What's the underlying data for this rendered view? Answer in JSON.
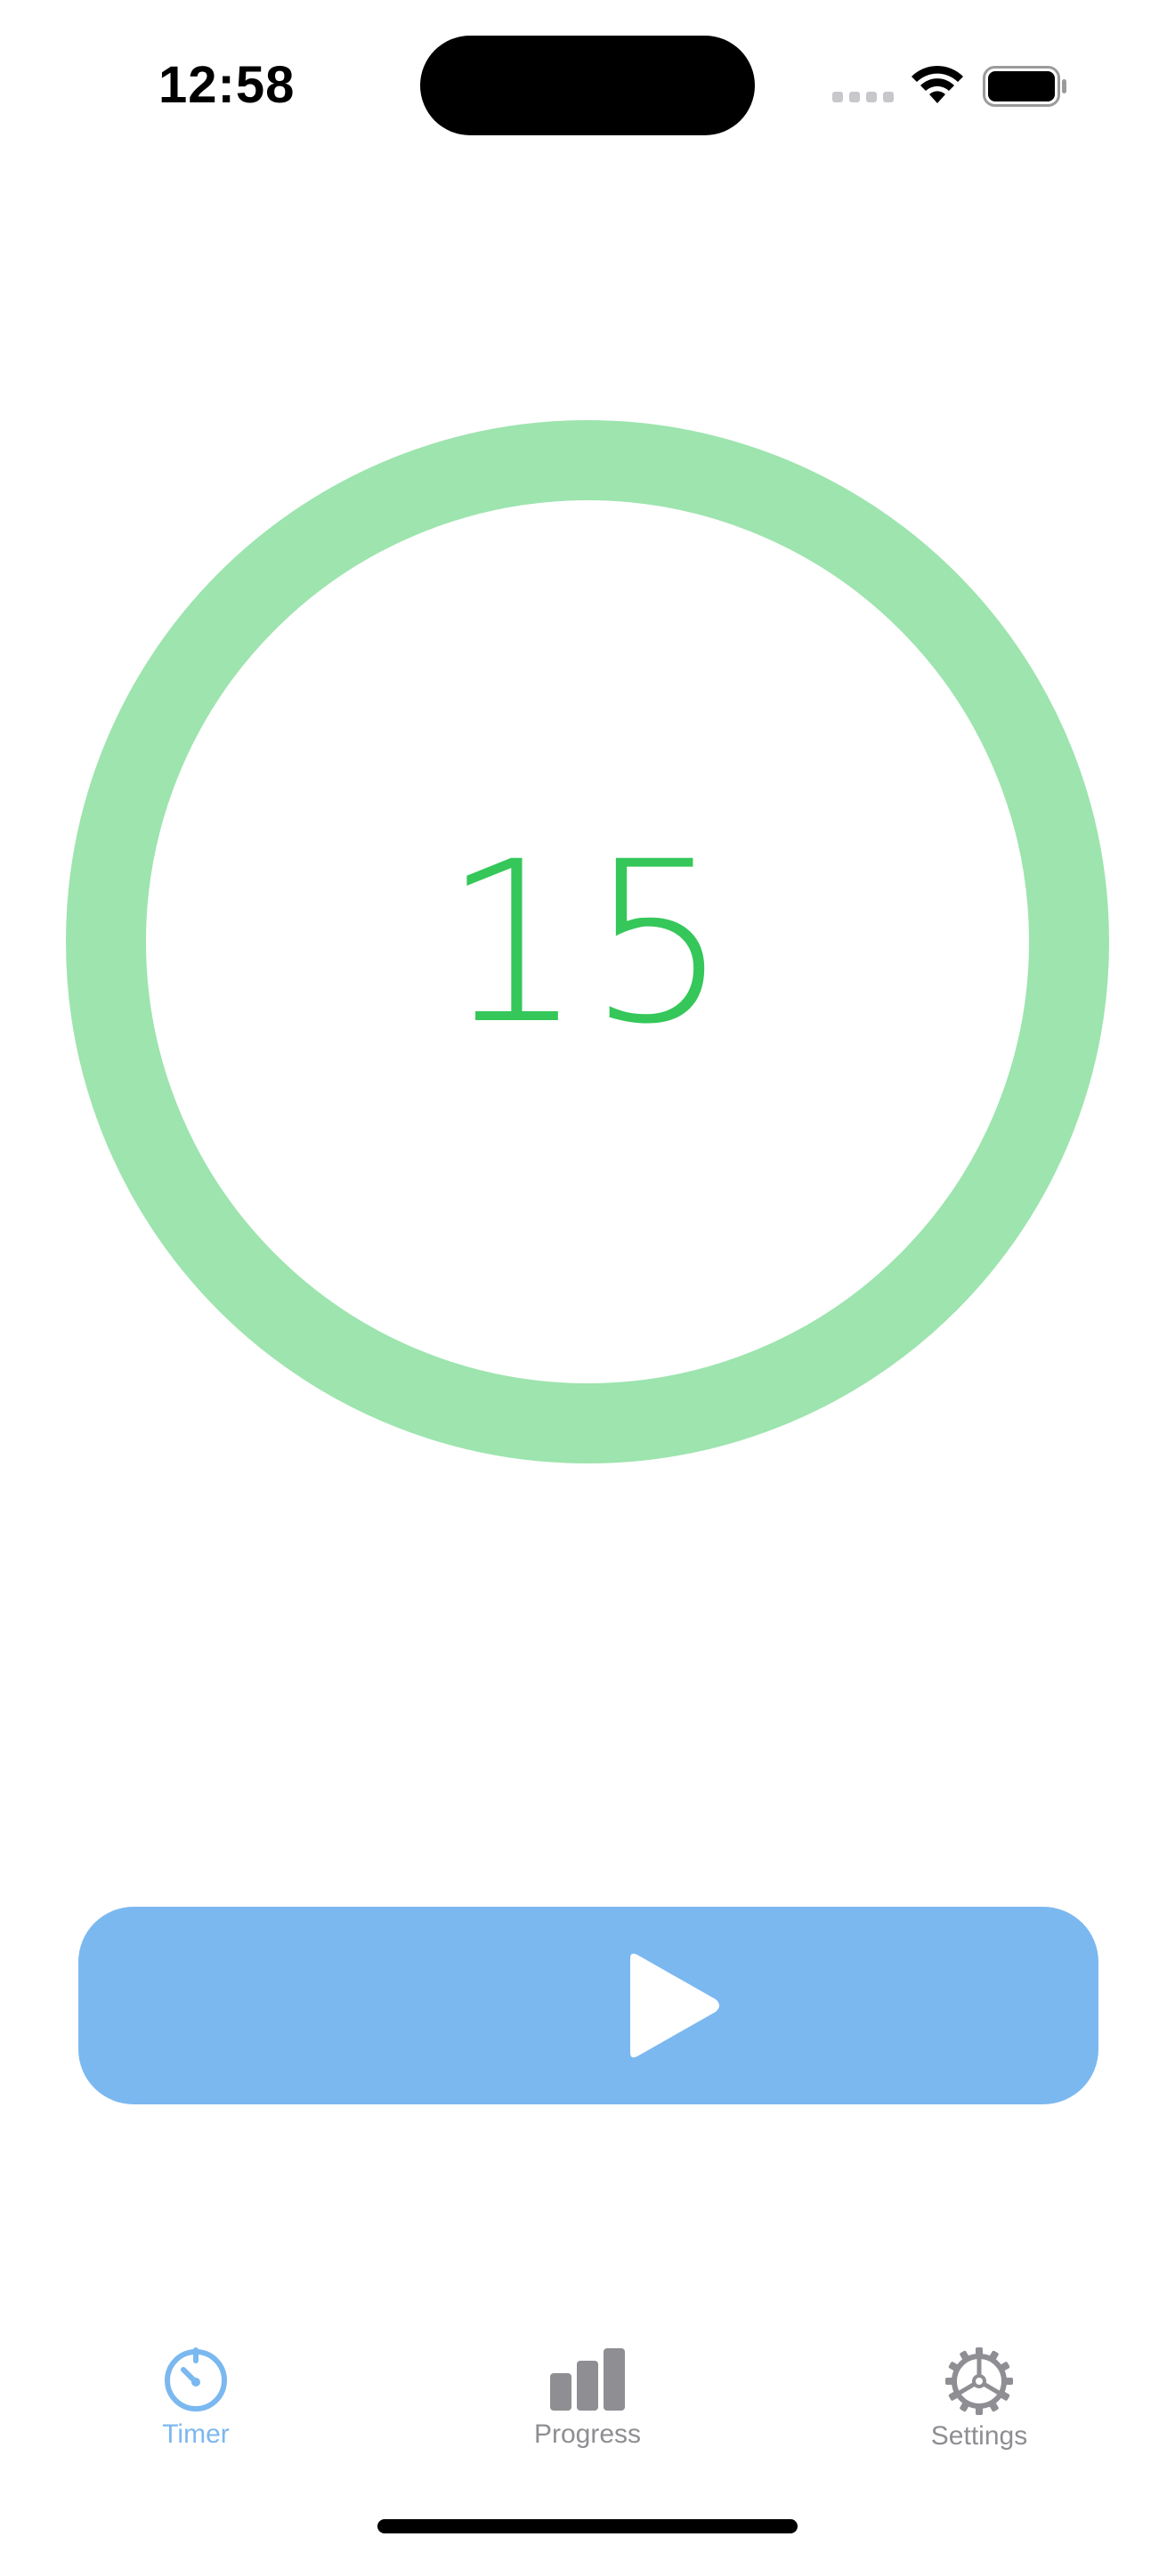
{
  "status_bar": {
    "time": "12:58",
    "icons": [
      "cellular-signal-icon",
      "wifi-icon",
      "battery-icon"
    ]
  },
  "timer": {
    "value": "15",
    "ring_progress": 1.0
  },
  "play_button": {
    "icon": "play-icon"
  },
  "tabs": [
    {
      "label": "Timer",
      "icon": "stopwatch-icon",
      "selected": true
    },
    {
      "label": "Progress",
      "icon": "bar-chart-icon",
      "selected": false
    },
    {
      "label": "Settings",
      "icon": "gear-icon",
      "selected": false
    }
  ],
  "colors": {
    "ring": "#9de4ae",
    "timer_text": "#35c759",
    "accent": "#7bb8f0",
    "inactive": "#8e8e93"
  }
}
